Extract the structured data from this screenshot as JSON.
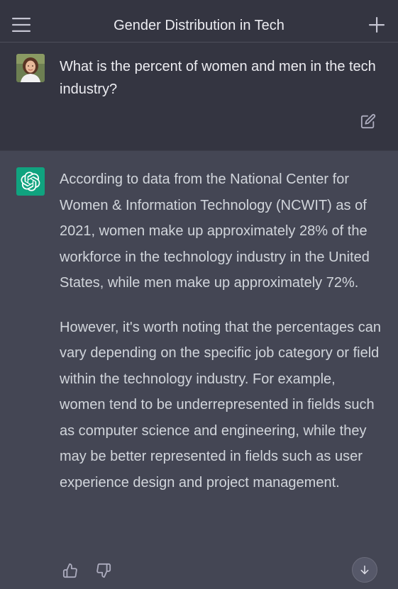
{
  "header": {
    "title": "Gender Distribution in Tech",
    "menu_icon": "hamburger-menu-icon",
    "new_chat_icon": "plus-icon"
  },
  "user_message": {
    "avatar": "user-avatar",
    "text": "What is the percent of women and men in the tech industry?",
    "edit_icon": "edit-icon"
  },
  "assistant_message": {
    "logo": "chatgpt-logo-icon",
    "paragraphs": [
      "According to data from the National Center for Women & Information Technology (NCWIT) as of 2021, women make up approximately 28% of the workforce in the technology industry in the United States, while men make up approximately 72%.",
      "However, it's worth noting that the percentages can vary depending on the specific job category or field within the technology industry. For example, women tend to be underrepresented in fields such as computer science and engineering, while they may be better represented in fields such as user experience design and project management."
    ],
    "thumbs_up_icon": "thumbs-up-icon",
    "thumbs_down_icon": "thumbs-down-icon",
    "scroll_icon": "arrow-down-icon"
  },
  "colors": {
    "background": "#343541",
    "assistant_background": "#444654",
    "accent": "#10a37f",
    "text": "#ececf1"
  }
}
